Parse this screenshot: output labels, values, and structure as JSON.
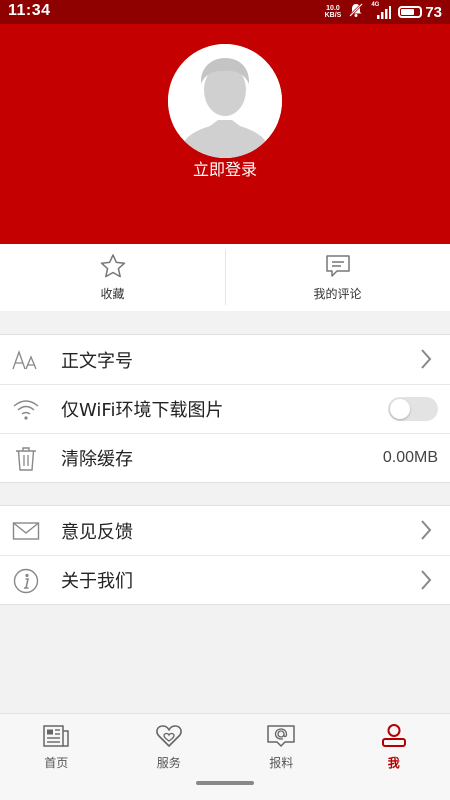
{
  "status_bar": {
    "time": "11:34",
    "net_speed_value": "10.0",
    "net_speed_unit": "KB/S",
    "network_type": "4G",
    "battery_level": 73,
    "battery_text": "73"
  },
  "profile": {
    "login_label": "立即登录"
  },
  "quick_actions": [
    {
      "label": "收藏",
      "icon": "star-icon"
    },
    {
      "label": "我的评论",
      "icon": "comment-icon"
    }
  ],
  "settings_group_1": [
    {
      "label": "正文字号",
      "icon": "font-size-icon",
      "control": "chevron"
    },
    {
      "label": "仅WiFi环境下载图片",
      "icon": "wifi-icon",
      "control": "toggle",
      "toggle_on": false
    },
    {
      "label": "清除缓存",
      "icon": "trash-icon",
      "control": "value",
      "value": "0.00MB"
    }
  ],
  "settings_group_2": [
    {
      "label": "意见反馈",
      "icon": "mail-icon",
      "control": "chevron"
    },
    {
      "label": "关于我们",
      "icon": "info-icon",
      "control": "chevron"
    }
  ],
  "tab_bar": {
    "active_index": 3,
    "tabs": [
      {
        "label": "首页",
        "icon": "news-icon"
      },
      {
        "label": "服务",
        "icon": "heart-icon"
      },
      {
        "label": "报料",
        "icon": "report-icon"
      },
      {
        "label": "我",
        "icon": "user-icon"
      }
    ]
  },
  "colors": {
    "header_red": "#c40000",
    "status_bar_red": "#8f0000",
    "active_tab": "#b30000",
    "background": "#f2f2f2"
  }
}
